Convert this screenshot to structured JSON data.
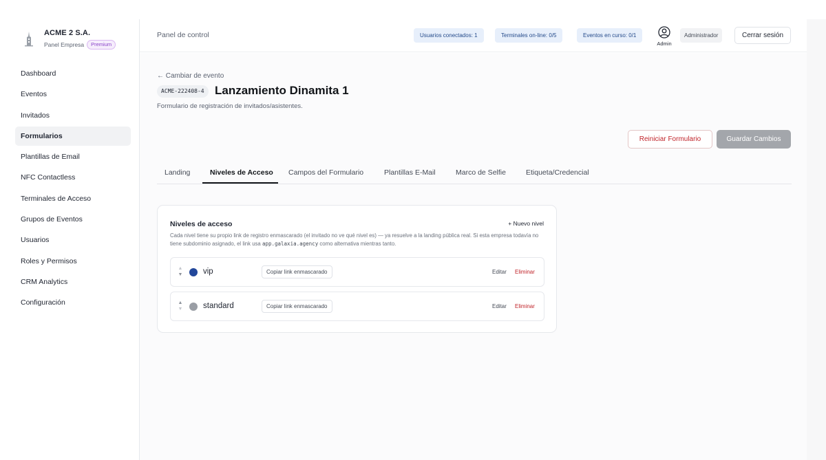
{
  "brand": {
    "name": "ACME 2 S.A.",
    "subtitle": "Panel Empresa",
    "plan_badge": "Premium"
  },
  "sidebar": {
    "items": [
      {
        "label": "Dashboard",
        "active": false
      },
      {
        "label": "Eventos",
        "active": false
      },
      {
        "label": "Invitados",
        "active": false
      },
      {
        "label": "Formularios",
        "active": true
      },
      {
        "label": "Plantillas de Email",
        "active": false
      },
      {
        "label": "NFC Contactless",
        "active": false
      },
      {
        "label": "Terminales de Acceso",
        "active": false
      },
      {
        "label": "Grupos de Eventos",
        "active": false
      },
      {
        "label": "Usuarios",
        "active": false
      },
      {
        "label": "Roles y Permisos",
        "active": false
      },
      {
        "label": "CRM Analytics",
        "active": false
      },
      {
        "label": "Configuración",
        "active": false
      }
    ]
  },
  "header": {
    "title": "Panel de control",
    "status_pills": {
      "users": "Usuarios conectados: 1",
      "terminals": "Terminales on-line: 0/5",
      "events": "Eventos en curso: 0/1"
    },
    "user_label": "Admin",
    "role": "Administrador",
    "logout_label": "Cerrar sesión"
  },
  "event": {
    "back_label": "← Cambiar de evento",
    "code": "ACME-222408-4",
    "title": "Lanzamiento Dinamita 1",
    "subtitle": "Formulario de registración de invitados/asistentes."
  },
  "actions": {
    "reset_label": "Reiniciar Formulario",
    "save_label": "Guardar Cambios"
  },
  "tabs": [
    {
      "label": "Landing",
      "active": false
    },
    {
      "label": "Niveles de Acceso",
      "active": true
    },
    {
      "label": "Campos del Formulario",
      "active": false
    },
    {
      "label": "Plantillas E-Mail",
      "active": false
    },
    {
      "label": "Marco de Selfie",
      "active": false
    },
    {
      "label": "Etiqueta/Credencial",
      "active": false
    }
  ],
  "access_levels": {
    "title": "Niveles de acceso",
    "add_label": "+ Nuevo nivel",
    "description_before": "Cada nivel tiene su propio link de registro enmascarado (el invitado no ve qué nivel es) — ya resuelve a la landing pública real. Si esta empresa todavía no tiene subdominio asignado, el link usa ",
    "description_domain": "app.galaxia.agency",
    "description_after": " como alternativa mientras tanto.",
    "levels": [
      {
        "name": "vip",
        "color": "#22479a",
        "copy_label": "Copiar link enmascarado",
        "edit_label": "Editar",
        "delete_label": "Eliminar",
        "arrow_up": "▲",
        "arrow_down": "▼"
      },
      {
        "name": "standard",
        "color": "#9a9ea5",
        "copy_label": "Copiar link enmascarado",
        "edit_label": "Editar",
        "delete_label": "Eliminar",
        "arrow_up": "▲",
        "arrow_down": "▼"
      }
    ]
  }
}
